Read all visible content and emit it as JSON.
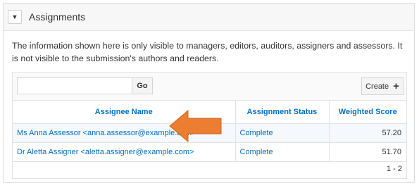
{
  "panel": {
    "title": "Assignments",
    "toggle_icon": "caret-down-icon"
  },
  "info_text": "The information shown here is only visible to managers, editors, auditors, assigners and assessors. It is not visible to the submission's authors and readers.",
  "toolbar": {
    "search_value": "",
    "go_label": "Go",
    "create_label": "Create",
    "create_icon": "plus-icon"
  },
  "table": {
    "columns": [
      "Assignee Name",
      "Assignment Status",
      "Weighted Score"
    ],
    "rows": [
      {
        "name": "Ms Anna Assessor <anna.assessor@example.com>",
        "status": "Complete",
        "score": "57.20"
      },
      {
        "name": "Dr Aletta Assigner <aletta.assigner@example.com>",
        "status": "Complete",
        "score": "51.70"
      }
    ],
    "pagination": "1 - 2"
  },
  "annotation": {
    "arrow_color": "#ED7D31",
    "arrow_icon": "left-arrow-icon"
  }
}
